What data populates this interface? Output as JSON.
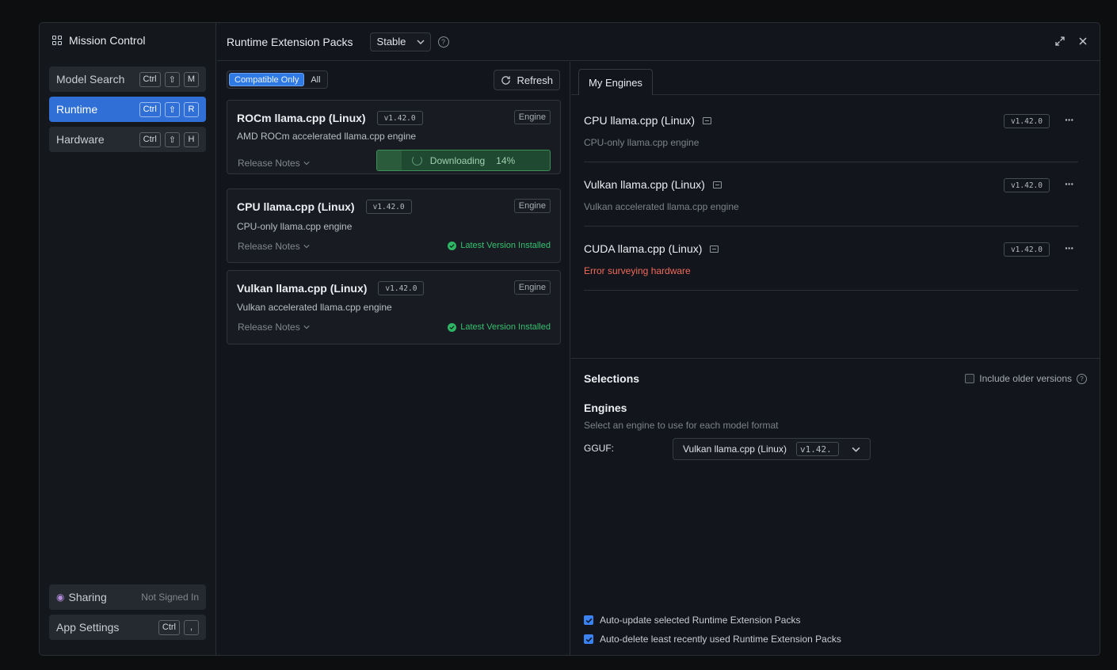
{
  "sidebar": {
    "title": "Mission Control",
    "items": [
      {
        "label": "Model Search",
        "keys": [
          "Ctrl",
          "⇧",
          "M"
        ]
      },
      {
        "label": "Runtime",
        "keys": [
          "Ctrl",
          "⇧",
          "R"
        ]
      },
      {
        "label": "Hardware",
        "keys": [
          "Ctrl",
          "⇧",
          "H"
        ]
      }
    ],
    "sharing": {
      "label": "Sharing",
      "status": "Not Signed In"
    },
    "app_settings": {
      "label": "App Settings",
      "keys": [
        "Ctrl",
        ","
      ]
    }
  },
  "header": {
    "title": "Runtime Extension Packs",
    "channel": "Stable",
    "help": "?"
  },
  "filters": {
    "compatible_only": "Compatible Only",
    "all": "All",
    "refresh": "Refresh"
  },
  "packs": [
    {
      "name": "ROCm llama.cpp (Linux)",
      "version": "v1.42.0",
      "tag": "Engine",
      "description": "AMD ROCm accelerated llama.cpp engine",
      "release_notes": "Release Notes",
      "download_label": "Downloading",
      "download_percent": "14%",
      "download_progress": 0.14
    },
    {
      "name": "CPU llama.cpp (Linux)",
      "version": "v1.42.0",
      "tag": "Engine",
      "description": "CPU-only llama.cpp engine",
      "release_notes": "Release Notes",
      "status": "Latest Version Installed"
    },
    {
      "name": "Vulkan llama.cpp (Linux)",
      "version": "v1.42.0",
      "tag": "Engine",
      "description": "Vulkan accelerated llama.cpp engine",
      "release_notes": "Release Notes",
      "status": "Latest Version Installed"
    }
  ],
  "my_engines": {
    "tab": "My Engines",
    "engines": [
      {
        "name": "CPU llama.cpp (Linux)",
        "version": "v1.42.0",
        "description": "CPU-only llama.cpp engine"
      },
      {
        "name": "Vulkan llama.cpp (Linux)",
        "version": "v1.42.0",
        "description": "Vulkan accelerated llama.cpp engine"
      },
      {
        "name": "CUDA llama.cpp (Linux)",
        "version": "v1.42.0",
        "description": "Error surveying hardware"
      }
    ],
    "more": "···"
  },
  "selections": {
    "title": "Selections",
    "include_older": "Include older versions",
    "engines_title": "Engines",
    "engines_desc": "Select an engine to use for each model format",
    "gguf_label": "GGUF:",
    "gguf_engine": "Vulkan llama.cpp (Linux)",
    "gguf_version": "v1.42.",
    "auto_update": "Auto-update selected Runtime Extension Packs",
    "auto_delete": "Auto-delete least recently used Runtime Extension Packs"
  },
  "colors": {
    "accent": "#2f6fd6",
    "success": "#34c070",
    "error": "#f06a5a"
  }
}
